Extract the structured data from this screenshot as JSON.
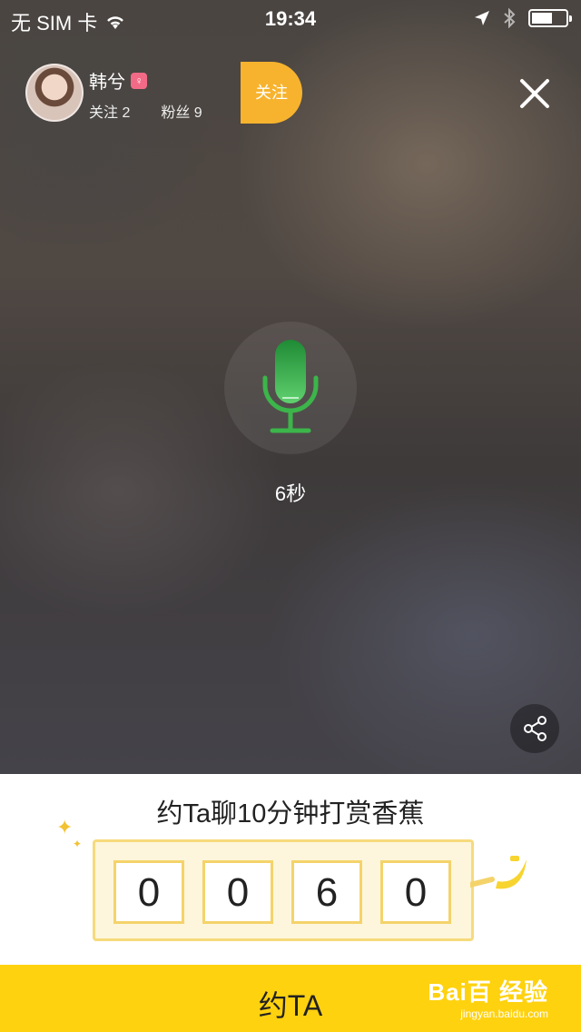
{
  "status_bar": {
    "carrier": "无 SIM 卡",
    "time": "19:34"
  },
  "profile": {
    "name": "韩兮",
    "badge_icon": "gender-female-icon",
    "following_label": "关注 2",
    "followers_label": "粉丝 9",
    "follow_button": "关注"
  },
  "recorder": {
    "mic_color": "#3cb54a",
    "duration": "6秒"
  },
  "reward": {
    "title": "约Ta聊10分钟打赏香蕉",
    "digits": [
      "0",
      "0",
      "6",
      "0"
    ],
    "accent_color": "#f4d36a"
  },
  "cta": {
    "label": "约TA",
    "color": "#ffd20f"
  },
  "watermark": {
    "logo": "Bai百 经验",
    "url": "jingyan.baidu.com"
  }
}
